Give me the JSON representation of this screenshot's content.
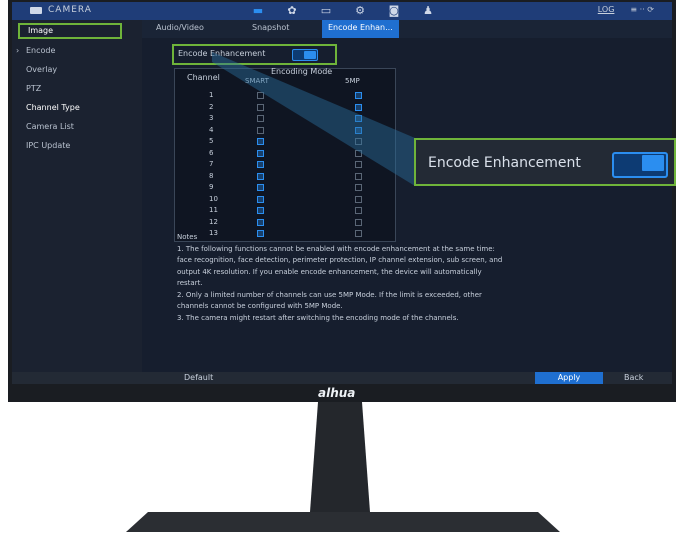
{
  "window": {
    "app_title": "CAMERA"
  },
  "top_right": {
    "label_a": "LOG",
    "label_b": "≡ ·· ⟳"
  },
  "sidebar": {
    "items": [
      {
        "label": "Image"
      },
      {
        "label": "Encode"
      },
      {
        "label": "Overlay"
      },
      {
        "label": "PTZ"
      },
      {
        "label": "Channel Type"
      },
      {
        "label": "Camera List"
      },
      {
        "label": "IPC Update"
      }
    ]
  },
  "tabs": [
    {
      "label": "Audio/Video"
    },
    {
      "label": "Snapshot"
    },
    {
      "label": "Encode Enhan..."
    }
  ],
  "encode_enhancement": {
    "label": "Encode Enhancement",
    "enabled": true
  },
  "table": {
    "channel_header": "Channel",
    "mode_header": "Encoding Mode",
    "col_smart": "SMART",
    "col_5mp": "5MP",
    "rows": [
      {
        "ch": "1",
        "smart": false,
        "mp5": true
      },
      {
        "ch": "2",
        "smart": false,
        "mp5": true
      },
      {
        "ch": "3",
        "smart": false,
        "mp5": true
      },
      {
        "ch": "4",
        "smart": false,
        "mp5": true
      },
      {
        "ch": "5",
        "smart": true,
        "mp5": false
      },
      {
        "ch": "6",
        "smart": true,
        "mp5": false
      },
      {
        "ch": "7",
        "smart": true,
        "mp5": false
      },
      {
        "ch": "8",
        "smart": true,
        "mp5": false
      },
      {
        "ch": "9",
        "smart": true,
        "mp5": false
      },
      {
        "ch": "10",
        "smart": true,
        "mp5": false
      },
      {
        "ch": "11",
        "smart": true,
        "mp5": false
      },
      {
        "ch": "12",
        "smart": true,
        "mp5": false
      },
      {
        "ch": "13",
        "smart": true,
        "mp5": false
      }
    ]
  },
  "notes": {
    "title": "Notes",
    "lines": [
      "1. The following functions cannot be enabled with encode enhancement at the same time:",
      "face recognition, face detection, perimeter protection, IP channel extension, sub screen, and",
      "output 4K resolution. If you enable encode enhancement, the device will automatically",
      "restart.",
      "2. Only a limited number of channels can use 5MP Mode. If the limit is exceeded, other",
      "channels cannot be configured with 5MP Mode.",
      "3. The camera might restart after switching the encoding mode of the channels."
    ]
  },
  "footer": {
    "default_label": "Default",
    "apply_label": "Apply",
    "back_label": "Back"
  },
  "brand": {
    "logo": "alhua"
  },
  "callout": {
    "label": "Encode Enhancement",
    "enabled": true
  },
  "colors": {
    "accent": "#2b8ef0",
    "highlight": "#6fb43a",
    "topbar": "#1f3d78"
  }
}
